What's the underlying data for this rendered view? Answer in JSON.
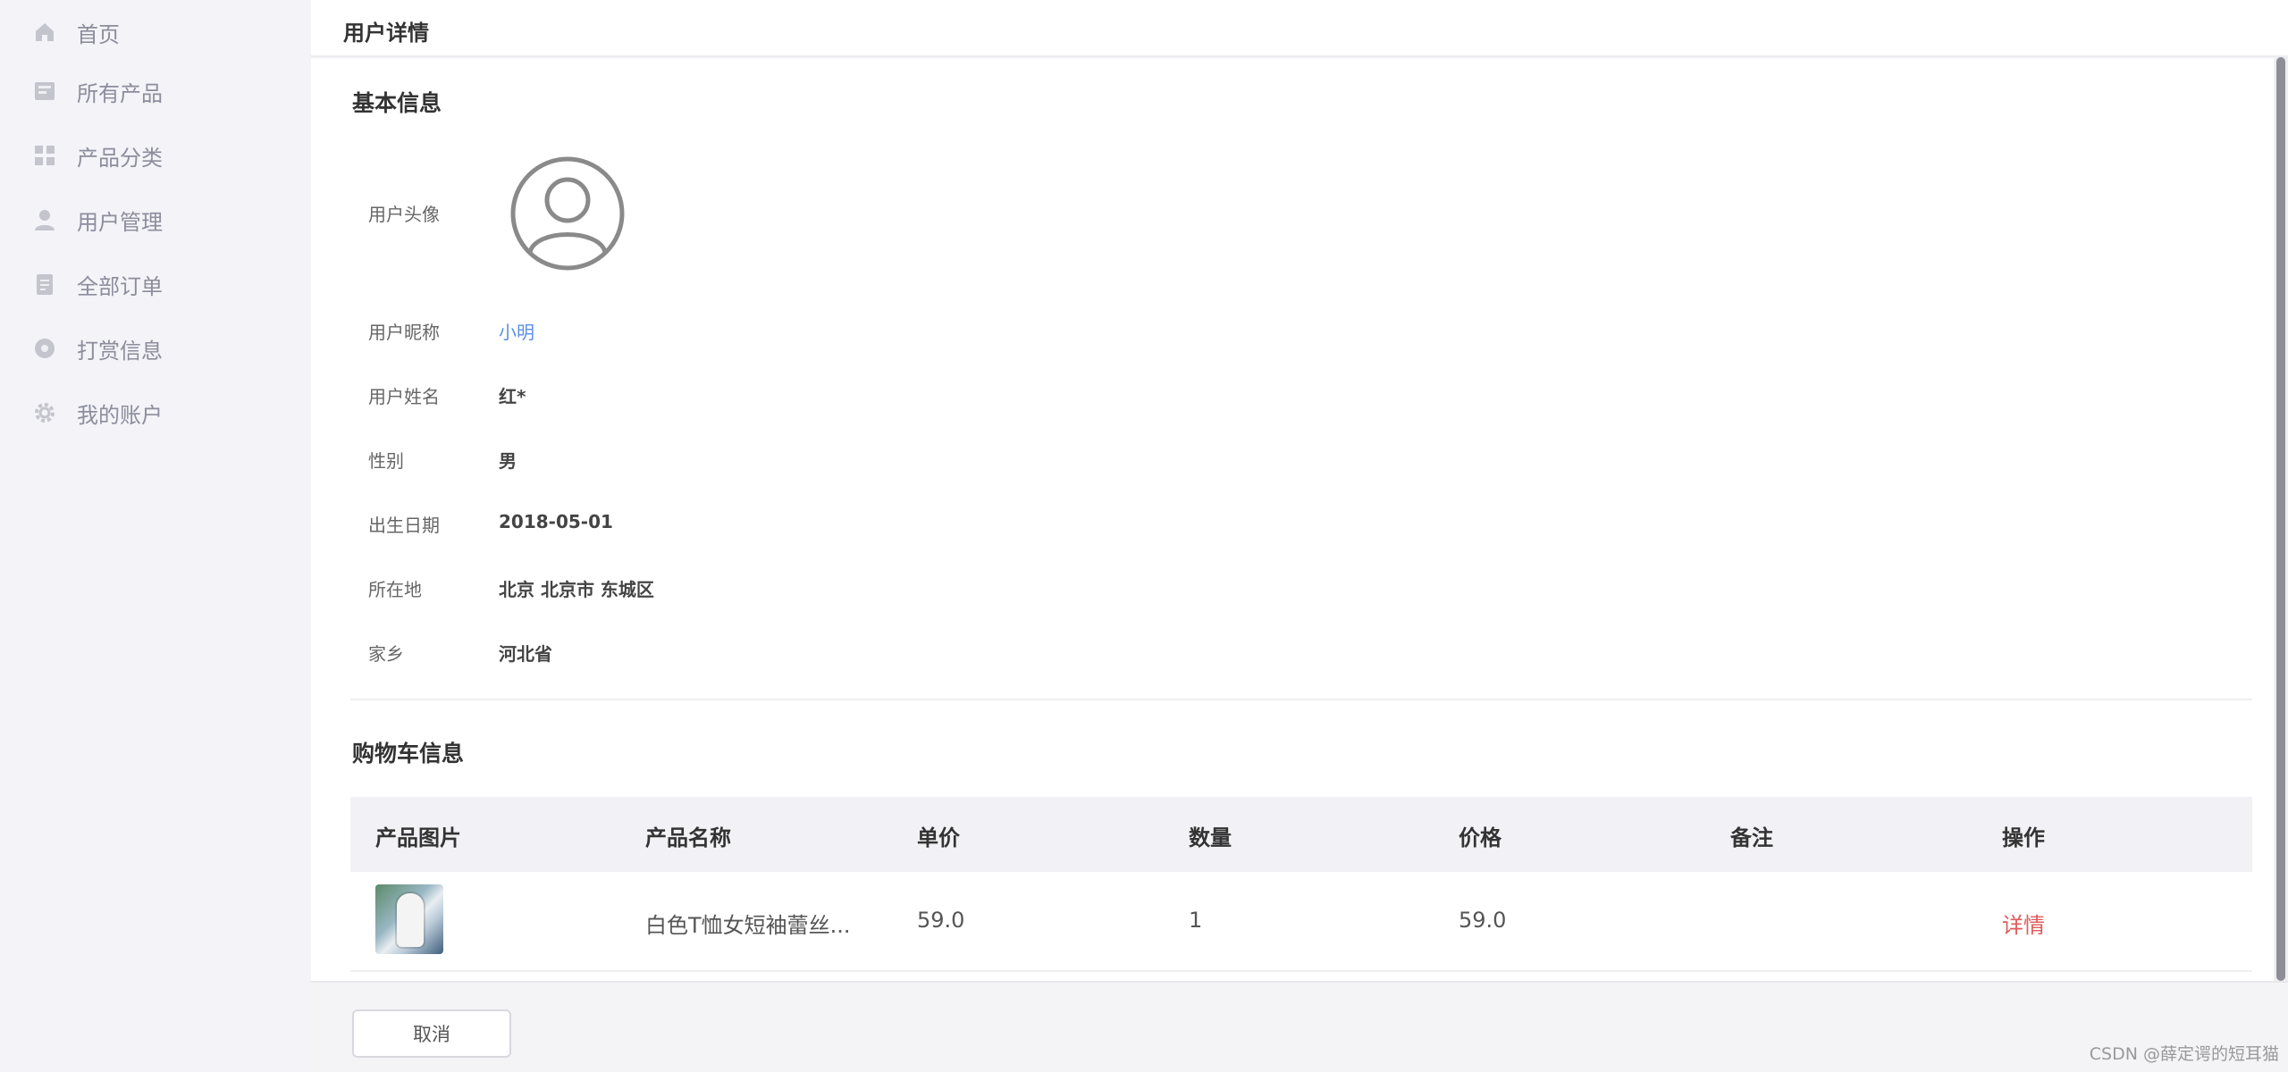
{
  "sidebar": {
    "items": [
      {
        "label": "首页",
        "icon": "home-icon"
      },
      {
        "label": "所有产品",
        "icon": "product-icon"
      },
      {
        "label": "产品分类",
        "icon": "category-icon"
      },
      {
        "label": "用户管理",
        "icon": "user-icon"
      },
      {
        "label": "全部订单",
        "icon": "order-icon"
      },
      {
        "label": "打赏信息",
        "icon": "reward-icon"
      },
      {
        "label": "我的账户",
        "icon": "gear-icon"
      }
    ]
  },
  "header": {
    "title": "用户详情"
  },
  "basic_info": {
    "section_title": "基本信息",
    "avatar_label": "用户头像",
    "fields": [
      {
        "label": "用户昵称",
        "value": "小明"
      },
      {
        "label": "用户姓名",
        "value": "红*"
      },
      {
        "label": "性别",
        "value": "男"
      },
      {
        "label": "出生日期",
        "value": "2018-05-01"
      },
      {
        "label": "所在地",
        "value": "北京 北京市 东城区"
      },
      {
        "label": "家乡",
        "value": "河北省"
      }
    ]
  },
  "cart": {
    "section_title": "购物车信息",
    "columns": [
      "产品图片",
      "产品名称",
      "单价",
      "数量",
      "价格",
      "备注",
      "操作"
    ],
    "rows": [
      {
        "name": "白色T恤女短袖蕾丝...",
        "unit_price": "59.0",
        "quantity": "1",
        "price": "59.0",
        "note": "",
        "action": "详情"
      }
    ]
  },
  "footer": {
    "cancel_label": "取消",
    "watermark": "CSDN @薛定谔的短耳猫"
  },
  "colors": {
    "link": "#5b8fe8",
    "action": "#e05a5a"
  }
}
